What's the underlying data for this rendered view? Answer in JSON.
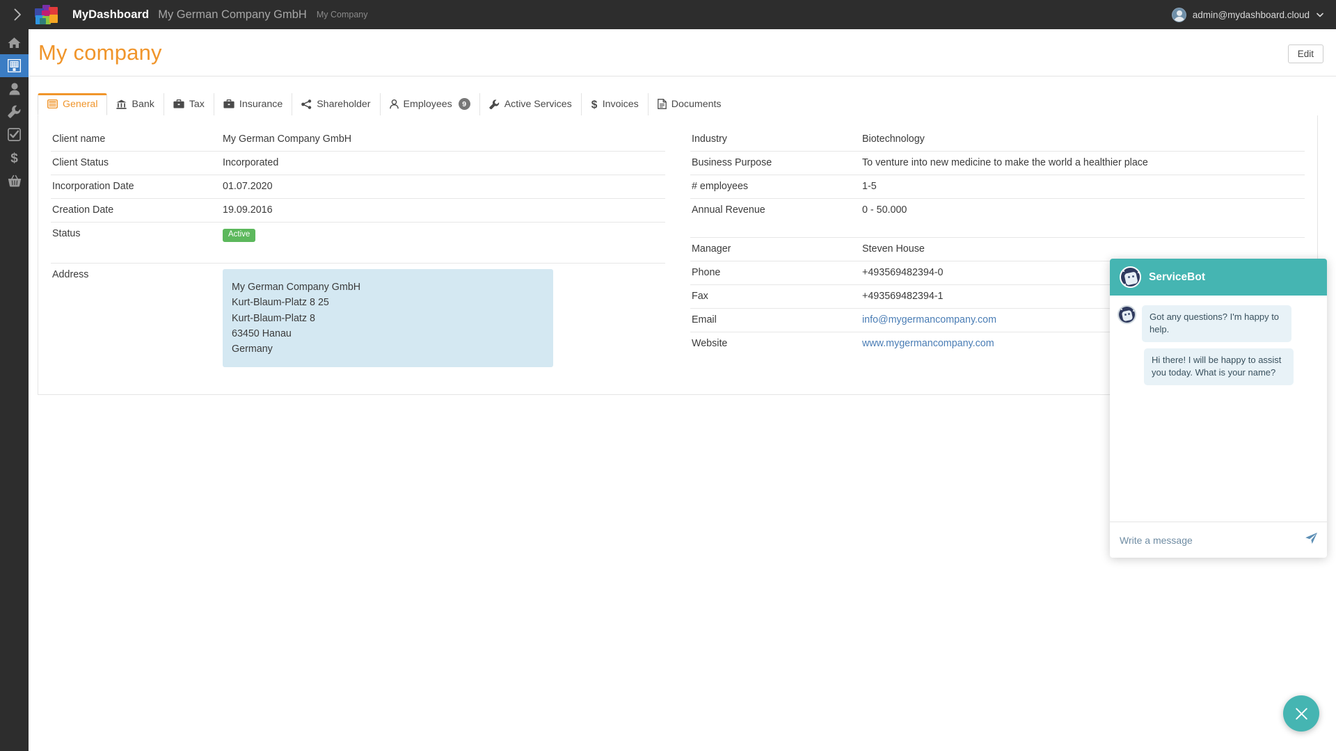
{
  "topbar": {
    "toggle_icon": "chevron-right-icon",
    "logo_icon": "mydashboard-logo",
    "brand": "MyDashboard",
    "company": "My German Company GmbH",
    "subtitle": "My Company",
    "user_email": "admin@mydashboard.cloud",
    "caret_icon": "chevron-down-icon",
    "background": "#2d2d2d"
  },
  "sidebar": {
    "active_color": "#3b7dc4",
    "items": [
      {
        "name": "home",
        "icon": "home-icon",
        "active": false
      },
      {
        "name": "company",
        "icon": "building-icon",
        "active": true
      },
      {
        "name": "user",
        "icon": "user-icon",
        "active": false
      },
      {
        "name": "tools",
        "icon": "wrench-icon",
        "active": false
      },
      {
        "name": "tasks",
        "icon": "check-square-icon",
        "active": false
      },
      {
        "name": "finance",
        "icon": "dollar-icon",
        "active": false
      },
      {
        "name": "shop",
        "icon": "basket-icon",
        "active": false
      }
    ]
  },
  "header": {
    "title": "My company",
    "title_color": "#f0952b",
    "edit_label": "Edit"
  },
  "tabs": [
    {
      "label": "General",
      "icon": "list-alt-icon",
      "active": true
    },
    {
      "label": "Bank",
      "icon": "bank-icon",
      "active": false
    },
    {
      "label": "Tax",
      "icon": "briefcase-icon",
      "active": false
    },
    {
      "label": "Insurance",
      "icon": "briefcase-icon",
      "active": false
    },
    {
      "label": "Shareholder",
      "icon": "share-icon",
      "active": false
    },
    {
      "label": "Employees",
      "icon": "user-icon",
      "badge": "9",
      "active": false
    },
    {
      "label": "Active Services",
      "icon": "wrench-icon",
      "active": false
    },
    {
      "label": "Invoices",
      "icon": "dollar-icon",
      "active": false
    },
    {
      "label": "Documents",
      "icon": "file-icon",
      "active": false
    }
  ],
  "left_column": {
    "rows": [
      {
        "key": "Client name",
        "value": "My German Company GmbH"
      },
      {
        "key": "Client Status",
        "value": "Incorporated"
      },
      {
        "key": "Incorporation Date",
        "value": "01.07.2020"
      },
      {
        "key": "Creation Date",
        "value": "19.09.2016"
      }
    ],
    "status_row": {
      "key": "Status",
      "badge": "Active",
      "badge_color": "#5cb85c"
    },
    "address_row": {
      "key": "Address",
      "background": "#d4e8f2",
      "lines": [
        "My German Company GmbH",
        "Kurt-Blaum-Platz 8 25",
        "Kurt-Blaum-Platz 8",
        "63450 Hanau",
        "Germany"
      ]
    }
  },
  "right_column": {
    "rows": [
      {
        "key": "Industry",
        "value": "Biotechnology"
      },
      {
        "key": "Business Purpose",
        "value": "To venture into new medicine to make the world a healthier place"
      },
      {
        "key": "# employees",
        "value": "1-5"
      },
      {
        "key": "Annual Revenue",
        "value": "0 - 50.000"
      }
    ],
    "contact_rows": [
      {
        "key": "Manager",
        "value": "Steven House",
        "link": false
      },
      {
        "key": "Phone",
        "value": "+493569482394-0",
        "link": false
      },
      {
        "key": "Fax",
        "value": "+493569482394-1",
        "link": false
      },
      {
        "key": "Email",
        "value": "info@mygermancompany.com",
        "link": true
      },
      {
        "key": "Website",
        "value": "www.mygermancompany.com",
        "link": true
      }
    ],
    "link_color": "#4a7db5"
  },
  "chat": {
    "title": "ServiceBot",
    "header_color": "#45b5b2",
    "avatar_icon": "servicebot-avatar",
    "messages": [
      {
        "text": "Got any questions? I'm happy to help.",
        "with_avatar": true
      },
      {
        "text": "Hi there!  I will be happy to assist you today. What is your name?",
        "with_avatar": false
      }
    ],
    "input_placeholder": "Write a message",
    "input_value": "",
    "send_icon": "send-icon",
    "close_icon": "close-icon"
  }
}
